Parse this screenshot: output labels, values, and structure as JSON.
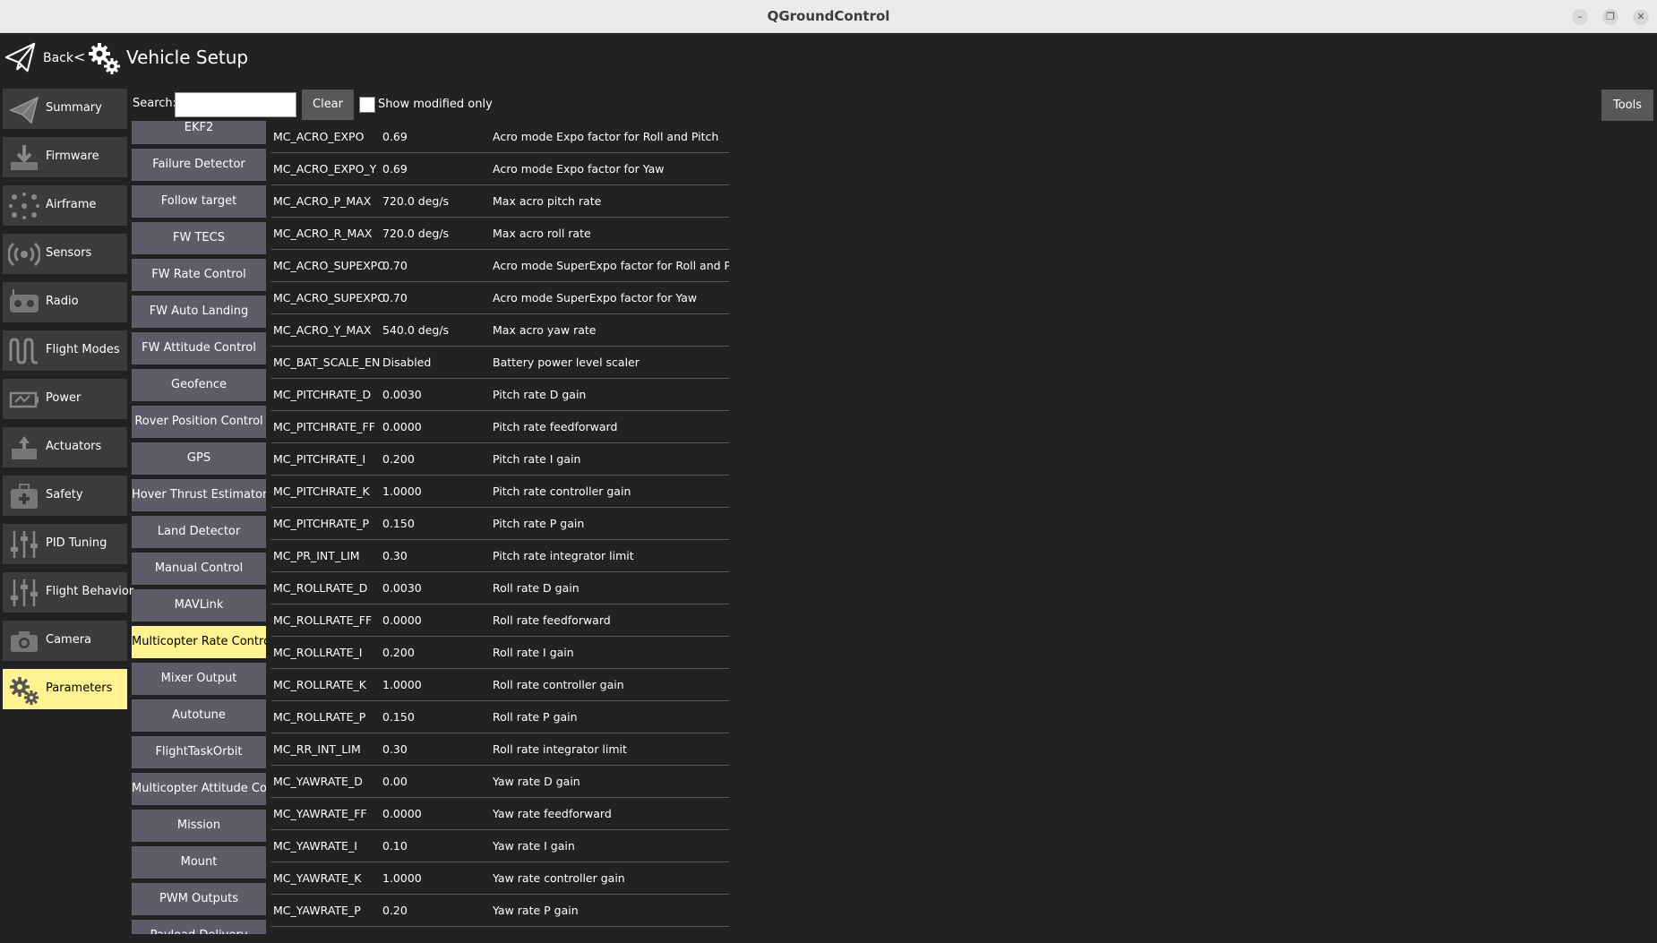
{
  "window": {
    "title": "QGroundControl"
  },
  "toolbar": {
    "back_label": "Back",
    "separator": "<",
    "page_title": "Vehicle Setup"
  },
  "sidebar": {
    "items": [
      {
        "label": "Summary",
        "icon": "paper-plane-icon"
      },
      {
        "label": "Firmware",
        "icon": "download-icon"
      },
      {
        "label": "Airframe",
        "icon": "airframe-icon"
      },
      {
        "label": "Sensors",
        "icon": "sensors-icon"
      },
      {
        "label": "Radio",
        "icon": "radio-icon"
      },
      {
        "label": "Flight Modes",
        "icon": "waveform-icon"
      },
      {
        "label": "Power",
        "icon": "battery-icon"
      },
      {
        "label": "Actuators",
        "icon": "actuator-icon"
      },
      {
        "label": "Safety",
        "icon": "first-aid-icon"
      },
      {
        "label": "PID Tuning",
        "icon": "sliders-icon"
      },
      {
        "label": "Flight Behavior",
        "icon": "sliders-icon"
      },
      {
        "label": "Camera",
        "icon": "camera-icon"
      },
      {
        "label": "Parameters",
        "icon": "gears-icon",
        "active": true
      }
    ]
  },
  "search": {
    "label": "Search:",
    "value": "",
    "clear_label": "Clear",
    "modified_only_label": "Show modified only",
    "modified_only_checked": false
  },
  "tools_label": "Tools",
  "groups": [
    "EKF2",
    "Failure Detector",
    "Follow target",
    "FW TECS",
    "FW Rate Control",
    "FW Auto Landing",
    "FW Attitude Control",
    "Geofence",
    "Rover Position Control",
    "GPS",
    "Hover Thrust Estimator",
    "Land Detector",
    "Manual Control",
    "MAVLink",
    "Multicopter Rate Control",
    "Mixer Output",
    "Autotune",
    "FlightTaskOrbit",
    "Multicopter Attitude Control",
    "Mission",
    "Mount",
    "PWM Outputs",
    "Payload Delivery"
  ],
  "active_group": "Multicopter Rate Control",
  "parameters": [
    {
      "name": "MC_ACRO_EXPO",
      "value": "0.69",
      "description": "Acro mode Expo factor for Roll and Pitch"
    },
    {
      "name": "MC_ACRO_EXPO_Y",
      "value": "0.69",
      "description": "Acro mode Expo factor for Yaw"
    },
    {
      "name": "MC_ACRO_P_MAX",
      "value": "720.0 deg/s",
      "description": "Max acro pitch rate"
    },
    {
      "name": "MC_ACRO_R_MAX",
      "value": "720.0 deg/s",
      "description": "Max acro roll rate"
    },
    {
      "name": "MC_ACRO_SUPEXPO",
      "value": "0.70",
      "description": "Acro mode SuperExpo factor for Roll and Pitch"
    },
    {
      "name": "MC_ACRO_SUPEXPOY",
      "value": "0.70",
      "description": "Acro mode SuperExpo factor for Yaw"
    },
    {
      "name": "MC_ACRO_Y_MAX",
      "value": "540.0 deg/s",
      "description": "Max acro yaw rate"
    },
    {
      "name": "MC_BAT_SCALE_EN",
      "value": "Disabled",
      "description": "Battery power level scaler"
    },
    {
      "name": "MC_PITCHRATE_D",
      "value": "0.0030",
      "description": "Pitch rate D gain"
    },
    {
      "name": "MC_PITCHRATE_FF",
      "value": "0.0000",
      "description": "Pitch rate feedforward"
    },
    {
      "name": "MC_PITCHRATE_I",
      "value": "0.200",
      "description": "Pitch rate I gain"
    },
    {
      "name": "MC_PITCHRATE_K",
      "value": "1.0000",
      "description": "Pitch rate controller gain"
    },
    {
      "name": "MC_PITCHRATE_P",
      "value": "0.150",
      "description": "Pitch rate P gain"
    },
    {
      "name": "MC_PR_INT_LIM",
      "value": "0.30",
      "description": "Pitch rate integrator limit"
    },
    {
      "name": "MC_ROLLRATE_D",
      "value": "0.0030",
      "description": "Roll rate D gain"
    },
    {
      "name": "MC_ROLLRATE_FF",
      "value": "0.0000",
      "description": "Roll rate feedforward"
    },
    {
      "name": "MC_ROLLRATE_I",
      "value": "0.200",
      "description": "Roll rate I gain"
    },
    {
      "name": "MC_ROLLRATE_K",
      "value": "1.0000",
      "description": "Roll rate controller gain"
    },
    {
      "name": "MC_ROLLRATE_P",
      "value": "0.150",
      "description": "Roll rate P gain"
    },
    {
      "name": "MC_RR_INT_LIM",
      "value": "0.30",
      "description": "Roll rate integrator limit"
    },
    {
      "name": "MC_YAWRATE_D",
      "value": "0.00",
      "description": "Yaw rate D gain"
    },
    {
      "name": "MC_YAWRATE_FF",
      "value": "0.0000",
      "description": "Yaw rate feedforward"
    },
    {
      "name": "MC_YAWRATE_I",
      "value": "0.10",
      "description": "Yaw rate I gain"
    },
    {
      "name": "MC_YAWRATE_K",
      "value": "1.0000",
      "description": "Yaw rate controller gain"
    },
    {
      "name": "MC_YAWRATE_P",
      "value": "0.20",
      "description": "Yaw rate P gain"
    }
  ],
  "colors": {
    "background": "#222222",
    "active": "#fff291",
    "group_button": "#5d5d6a",
    "sidebar_item": "#3b3b3b",
    "titlebar": "#ebebeb"
  }
}
